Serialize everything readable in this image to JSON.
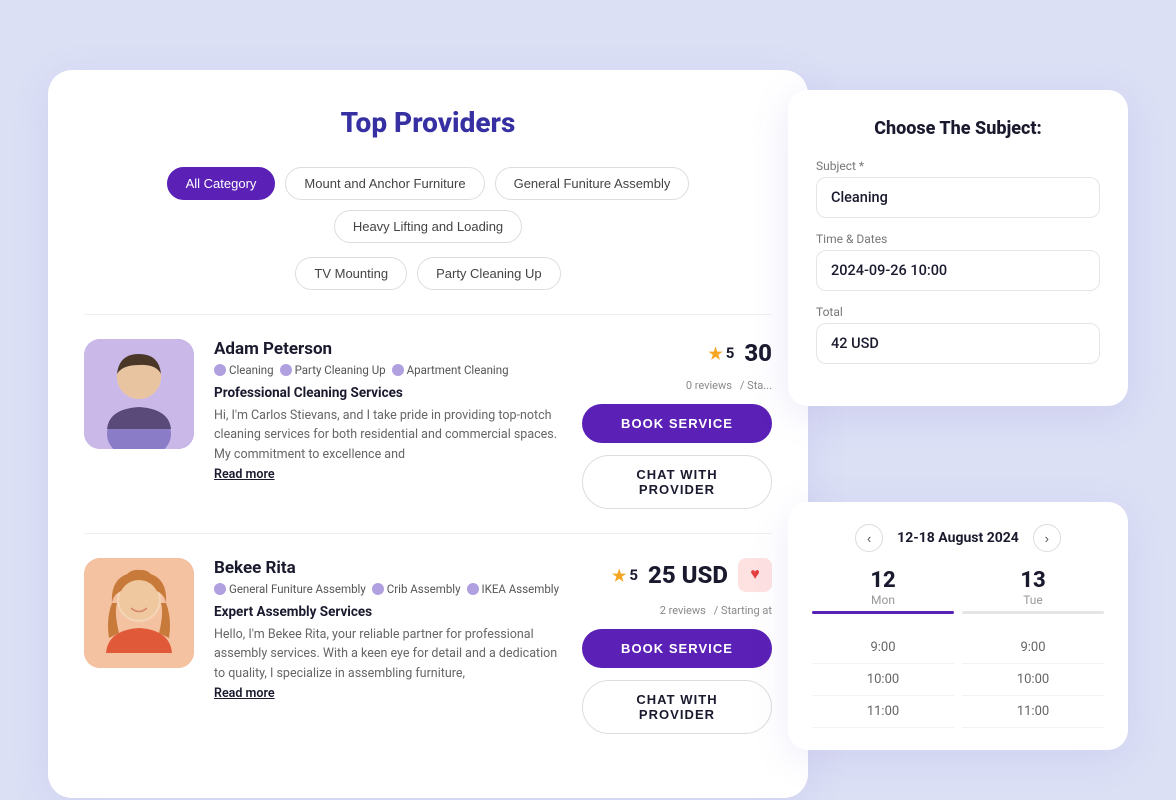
{
  "page": {
    "background": "#dce0f5"
  },
  "providers_card": {
    "title": "Top Providers",
    "filters_row1": [
      {
        "label": "All Category",
        "active": true
      },
      {
        "label": "Mount and Anchor Furniture",
        "active": false
      },
      {
        "label": "General Funiture Assembly",
        "active": false
      },
      {
        "label": "Heavy Lifting and Loading",
        "active": false
      }
    ],
    "filters_row2": [
      {
        "label": "TV Mounting",
        "active": false
      },
      {
        "label": "Party Cleaning Up",
        "active": false
      }
    ],
    "providers": [
      {
        "id": 1,
        "name": "Adam Peterson",
        "tags": [
          "Cleaning",
          "Party Cleaning Up",
          "Apartment Cleaning"
        ],
        "service_title": "Professional Cleaning Services",
        "description": "Hi, I'm Carlos Stievans, and I take pride in providing top-notch cleaning services for both residential and commercial spaces. My commitment to excellence and",
        "read_more": "Read more",
        "star": "★",
        "rating": "5",
        "reviews": "0 reviews",
        "price": "30",
        "price_unit": "",
        "starting_label": "/ Sta...",
        "book_label": "BOOK SERVICE",
        "chat_label": "CHAT WITH PROVIDER",
        "gender": "male"
      },
      {
        "id": 2,
        "name": "Bekee Rita",
        "tags": [
          "General Funiture Assembly",
          "Crib Assembly",
          "IKEA Assembly"
        ],
        "service_title": "Expert Assembly Services",
        "description": "Hello, I'm Bekee Rita, your reliable partner for professional assembly services. With a keen eye for detail and a dedication to quality, I specialize in assembling furniture,",
        "read_more": "Read more",
        "star": "★",
        "rating": "5",
        "reviews": "2 reviews",
        "price": "25 USD",
        "price_unit": "USD",
        "starting_label": "/ Starting at",
        "book_label": "BOOK SERVICE",
        "chat_label": "CHAT WITH PROVIDER",
        "has_heart": true,
        "gender": "female"
      }
    ]
  },
  "subject_card": {
    "title": "Choose The Subject:",
    "fields": [
      {
        "label": "Subject *",
        "value": "Cleaning"
      },
      {
        "label": "Time & Dates",
        "value": "2024-09-26 10:00"
      },
      {
        "label": "Total",
        "value": "42 USD"
      }
    ]
  },
  "calendar_card": {
    "range": "12-18 August 2024",
    "nav_prev": "‹",
    "nav_next": "›",
    "days": [
      {
        "num": "12",
        "label": "Mon",
        "bar_class": "bar-purple"
      },
      {
        "num": "13",
        "label": "Tue",
        "bar_class": "bar-gray"
      }
    ],
    "times": [
      {
        "col1": "9:00",
        "col2": "9:00"
      },
      {
        "col1": "10:00",
        "col2": "10:00"
      },
      {
        "col1": "11:00",
        "col2": "11:00"
      }
    ]
  }
}
